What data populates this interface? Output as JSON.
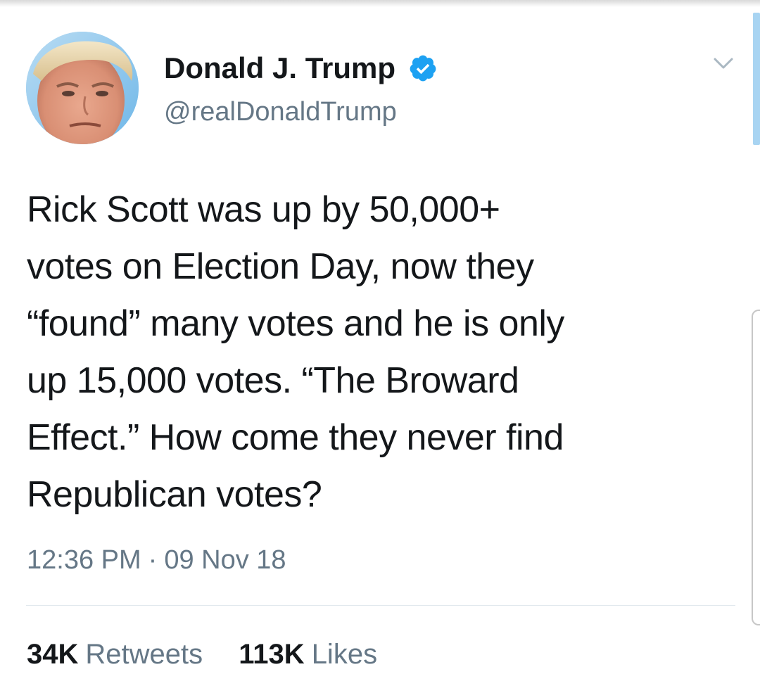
{
  "colors": {
    "text_primary": "#14171a",
    "text_secondary": "#657786",
    "verified_blue": "#1da1f2",
    "divider": "#e1e8ed"
  },
  "author": {
    "display_name": "Donald J. Trump",
    "handle": "@realDonaldTrump",
    "verified": true,
    "avatar_icon": "profile-photo",
    "verified_icon": "verified-badge-icon"
  },
  "menu": {
    "icon": "chevron-down-icon"
  },
  "tweet": {
    "text_lines": [
      "Rick Scott was up by 50,000+",
      "votes on Election Day, now they",
      "“found” many votes and he is only",
      "up 15,000 votes. “The Broward",
      "Effect.” How come they never find",
      "Republican votes?"
    ],
    "time": "12:36 PM",
    "separator": "·",
    "date": "09 Nov 18"
  },
  "stats": {
    "retweets": {
      "count": "34K",
      "label": "Retweets"
    },
    "likes": {
      "count": "113K",
      "label": "Likes"
    }
  }
}
